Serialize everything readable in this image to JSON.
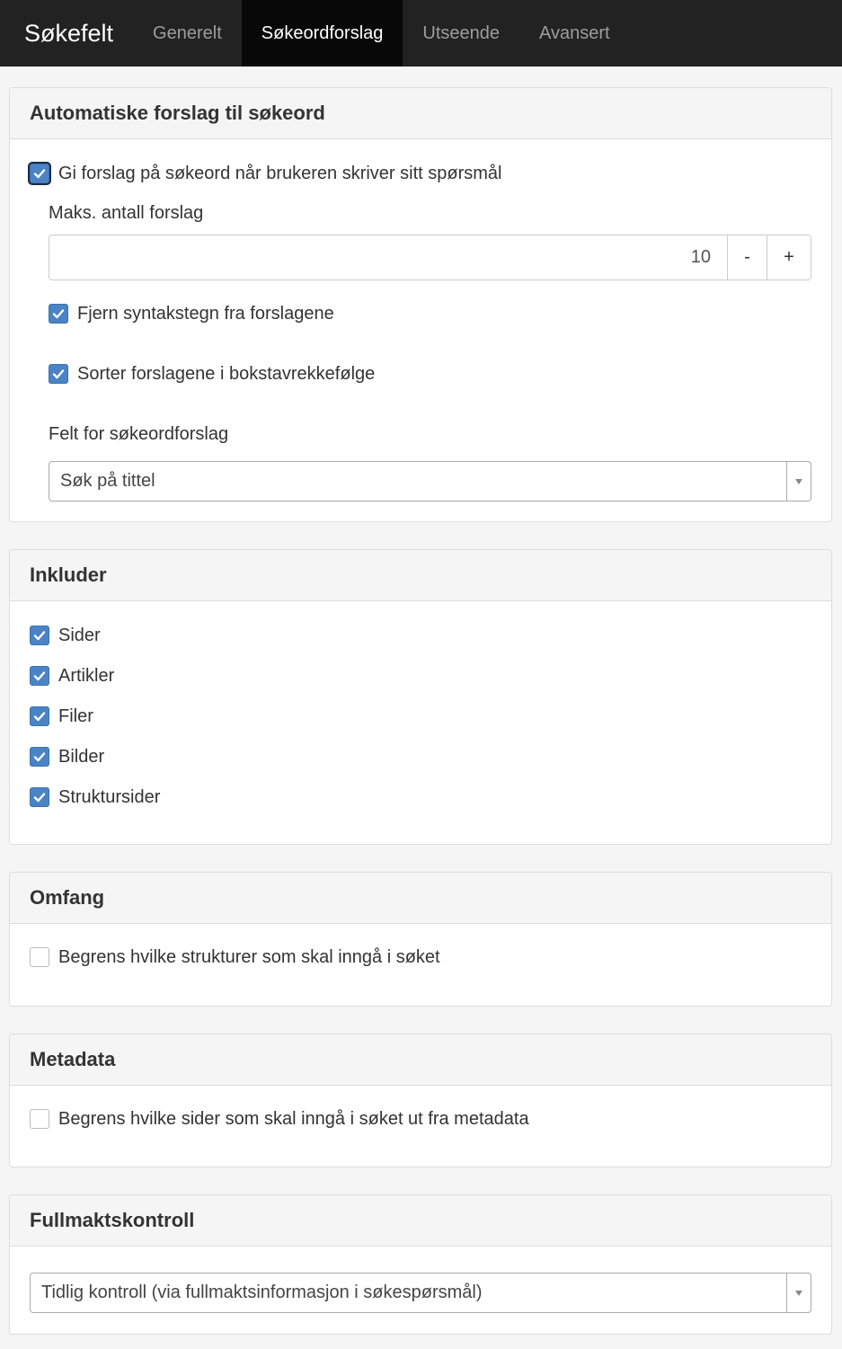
{
  "nav": {
    "brand": "Søkefelt",
    "tabs": [
      "Generelt",
      "Søkeordforslag",
      "Utseende",
      "Avansert"
    ],
    "active_tab": "Søkeordforslag"
  },
  "autosuggest": {
    "heading": "Automatiske forslag til søkeord",
    "enable_label": "Gi forslag på søkeord når brukeren skriver sitt spørsmål",
    "enable_checked": true,
    "max_label": "Maks. antall forslag",
    "max_value": "10",
    "decrement": "-",
    "increment": "+",
    "strip_label": "Fjern syntakstegn fra forslagene",
    "strip_checked": true,
    "sort_label": "Sorter forslagene i bokstavrekkefølge",
    "sort_checked": true,
    "field_label": "Felt for søkeordforslag",
    "field_value": "Søk på tittel"
  },
  "include": {
    "heading": "Inkluder",
    "items": [
      {
        "label": "Sider",
        "checked": true
      },
      {
        "label": "Artikler",
        "checked": true
      },
      {
        "label": "Filer",
        "checked": true
      },
      {
        "label": "Bilder",
        "checked": true
      },
      {
        "label": "Struktursider",
        "checked": true
      }
    ]
  },
  "scope": {
    "heading": "Omfang",
    "limit_label": "Begrens hvilke strukturer som skal inngå i søket",
    "limit_checked": false
  },
  "metadata": {
    "heading": "Metadata",
    "limit_label": "Begrens hvilke sider som skal inngå i søket ut fra metadata",
    "limit_checked": false
  },
  "access": {
    "heading": "Fullmaktskontroll",
    "value": "Tidlig kontroll (via fullmaktsinformasjon i søkespørsmål)"
  },
  "colors": {
    "navbar": "#222222",
    "active_tab": "#080808",
    "checkbox_checked": "#4a83c6"
  }
}
